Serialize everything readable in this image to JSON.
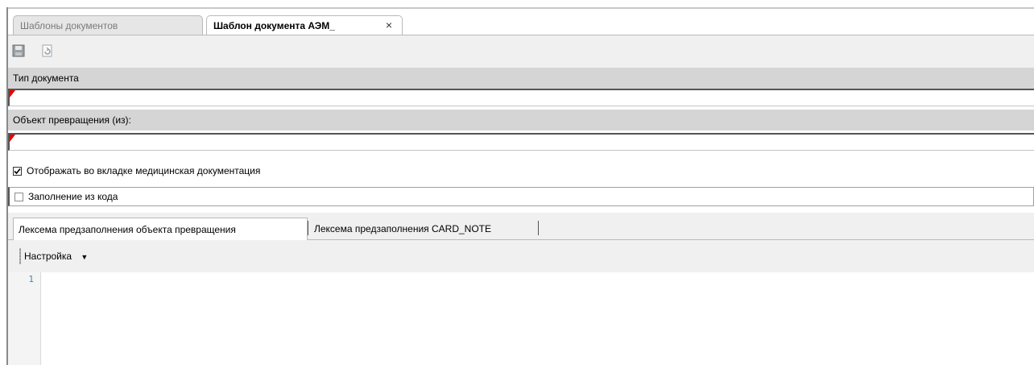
{
  "tabs": [
    {
      "label": "Шаблоны документов",
      "active": false
    },
    {
      "label": "Шаблон документа АЭМ_",
      "active": true,
      "close": "×"
    }
  ],
  "toolbar": {
    "icons": [
      "save-icon",
      "refresh-icon"
    ]
  },
  "fields": {
    "doc_type_label": "Тип документа",
    "doc_type_value": "",
    "transform_object_label": "Объект превращения (из):",
    "transform_object_value": ""
  },
  "checkboxes": {
    "show_in_medical_docs": {
      "label": "Отображать во вкладке медицинская документация",
      "checked": true
    },
    "fill_from_code": {
      "label": "Заполнение из кода",
      "checked": false
    }
  },
  "inner_tabs": [
    {
      "label": "Лексема предзаполнения объекта превращения",
      "active": true
    },
    {
      "label": "Лексема предзаполнения CARD_NOTE",
      "active": false
    }
  ],
  "editor": {
    "settings_label": "Настройка",
    "line_numbers": [
      "1"
    ]
  },
  "colors": {
    "required_marker": "#e60000",
    "band": "#d5d5d5",
    "line_number": "#2b91af"
  }
}
